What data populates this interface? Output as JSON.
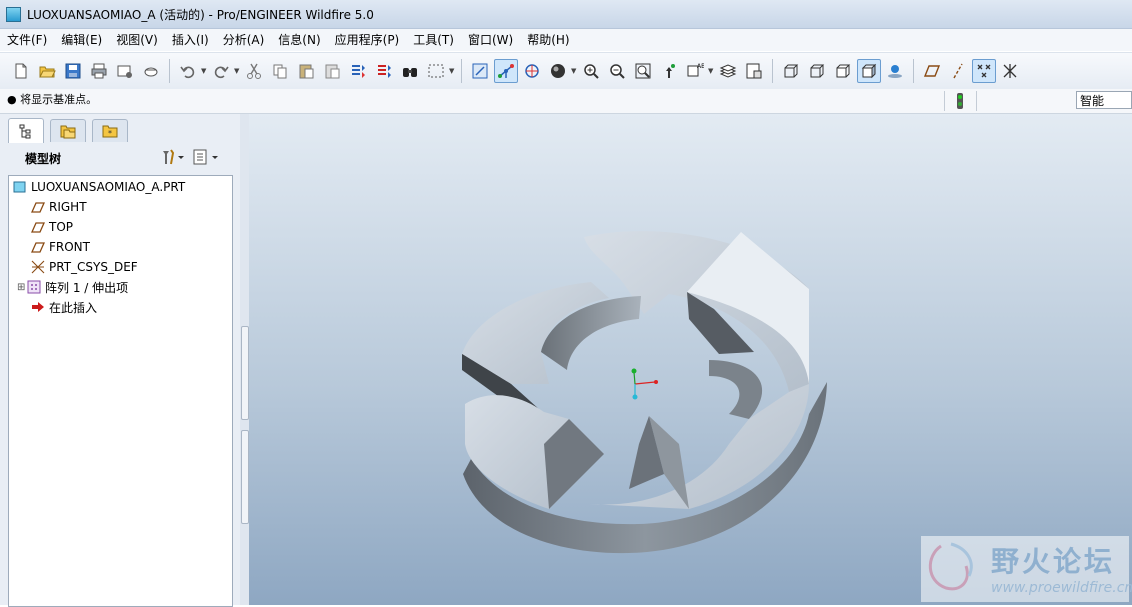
{
  "window": {
    "title": "LUOXUANSAOMIAO_A (活动的) - Pro/ENGINEER Wildfire 5.0"
  },
  "menu": {
    "items": [
      "文件(F)",
      "编辑(E)",
      "视图(V)",
      "插入(I)",
      "分析(A)",
      "信息(N)",
      "应用程序(P)",
      "工具(T)",
      "窗口(W)",
      "帮助(H)"
    ]
  },
  "toolbar": {
    "file_icons": [
      "new-file-icon",
      "open-folder-icon",
      "save-icon",
      "print-icon",
      "send-mail-icon",
      "copy-mail-icon"
    ],
    "edit_icons": [
      "undo-icon",
      "redo-icon",
      "cut-icon",
      "copy-icon",
      "paste-icon",
      "paste-special-icon",
      "regenerate-icon",
      "regen-manager-icon",
      "find-icon",
      "selection-box-icon"
    ],
    "view_icons": [
      "repaint-icon",
      "spin-center-icon",
      "orient-mode-icon",
      "appearance-sphere-icon",
      "zoom-in-icon",
      "zoom-out-icon",
      "refit-icon",
      "reorient-icon",
      "saved-views-icon",
      "layers-icon",
      "view-manager-icon"
    ],
    "display_icons": [
      "wireframe-icon",
      "hidden-line-icon",
      "no-hidden-icon",
      "shading-icon",
      "enhanced-realism-icon"
    ],
    "datum_icons": [
      "datum-planes-icon",
      "datum-axes-icon",
      "datum-points-icon",
      "coordinate-systems-icon"
    ]
  },
  "status": {
    "message": "将显示基准点。",
    "filter": "智能"
  },
  "model_tree": {
    "title": "模型树",
    "items": [
      {
        "label": "LUOXUANSAOMIAO_A.PRT",
        "icon": "part-icon"
      },
      {
        "label": "RIGHT",
        "icon": "datum-plane-icon"
      },
      {
        "label": "TOP",
        "icon": "datum-plane-icon"
      },
      {
        "label": "FRONT",
        "icon": "datum-plane-icon"
      },
      {
        "label": "PRT_CSYS_DEF",
        "icon": "csys-icon"
      },
      {
        "label": "阵列 1 / 伸出项",
        "icon": "pattern-icon"
      },
      {
        "label": "在此插入",
        "icon": "insert-here-arrow-icon"
      }
    ]
  },
  "watermark": {
    "brand": "野火论坛",
    "url": "www.proewildfire.cn"
  },
  "colors": {
    "viewport_top": "#e3ebf3",
    "viewport_bottom": "#8ea7c2",
    "model_light": "#c9d3dd",
    "model_dark": "#555b62",
    "accent": "#2a9bd0"
  }
}
